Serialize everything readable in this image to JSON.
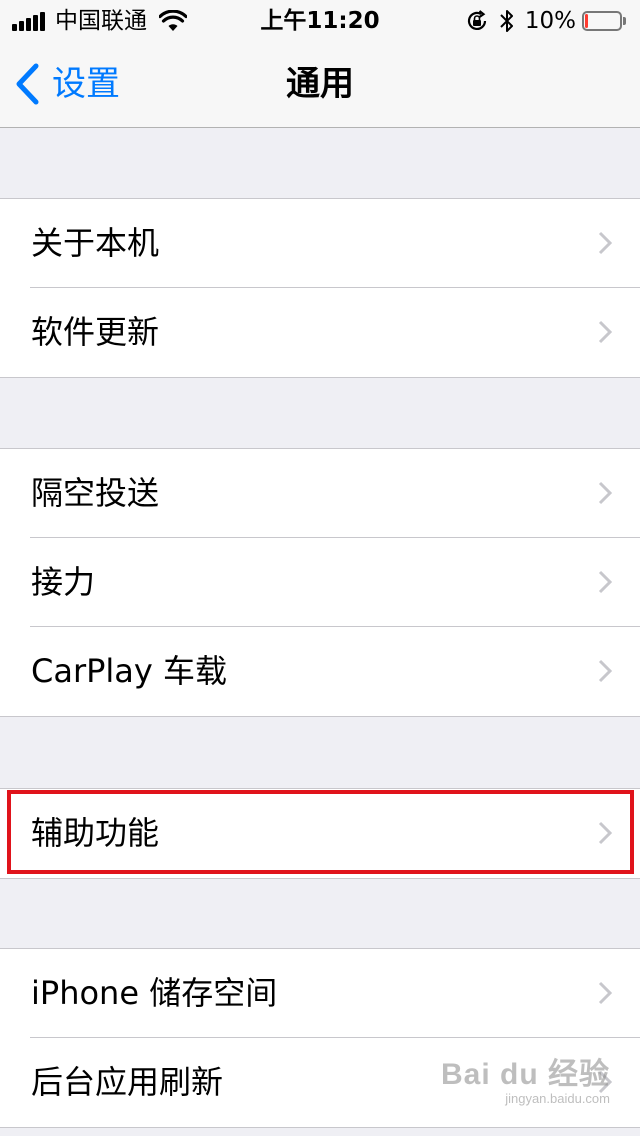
{
  "status_bar": {
    "carrier": "中国联通",
    "time": "上午11:20",
    "battery_percent": "10%",
    "battery_level": 0.1,
    "battery_color": "#ff3b30"
  },
  "nav": {
    "back_label": "设置",
    "title": "通用",
    "accent_color": "#007aff"
  },
  "groups": [
    {
      "items": [
        {
          "label": "关于本机"
        },
        {
          "label": "软件更新"
        }
      ]
    },
    {
      "items": [
        {
          "label": "隔空投送"
        },
        {
          "label": "接力"
        },
        {
          "label": "CarPlay 车载"
        }
      ]
    },
    {
      "items": [
        {
          "label": "辅助功能",
          "highlighted": true
        }
      ]
    },
    {
      "items": [
        {
          "label": "iPhone 储存空间"
        },
        {
          "label": "后台应用刷新"
        }
      ]
    }
  ],
  "highlight_color": "#e0131b",
  "watermark": {
    "main": "Bai du 经验",
    "sub": "jingyan.baidu.com"
  }
}
